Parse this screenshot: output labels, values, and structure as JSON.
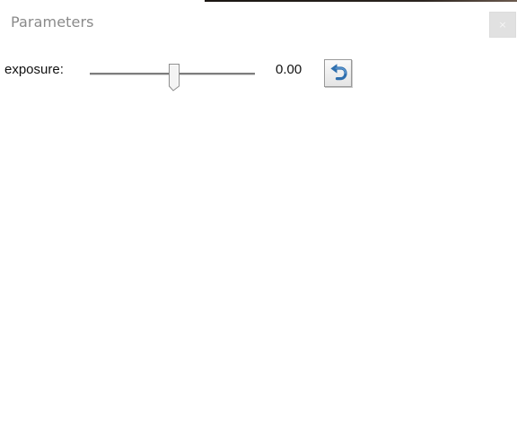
{
  "window": {
    "title": "Parameters",
    "close_label": "×"
  },
  "parameters": [
    {
      "label": "exposure:",
      "value_text": "0.00",
      "slider_position": 0.5
    }
  ],
  "icons": {
    "close": "close-icon",
    "reset": "reset-arrow-icon"
  },
  "colors": {
    "title": "#8a8a8a",
    "reset_arrow": "#3a78b8"
  }
}
